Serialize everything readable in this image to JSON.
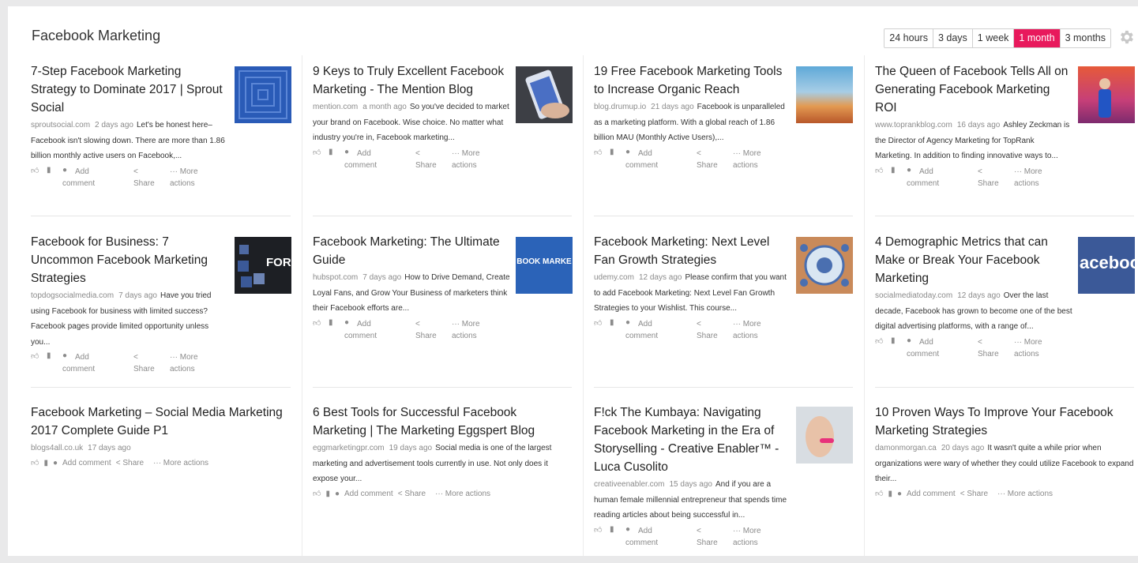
{
  "header": {
    "title": "Facebook Marketing",
    "time_filters": [
      "24 hours",
      "3 days",
      "1 week",
      "1 month",
      "3 months"
    ],
    "active_filter": "1 month",
    "accent": "#e8195c",
    "settings_icon": "gear-icon"
  },
  "actions": {
    "like_icon": "thumbs-up-icon",
    "bookmark_icon": "bookmark-icon",
    "comment_icon": "comment-icon",
    "share_icon": "share-icon",
    "more_icon": "ellipsis-icon",
    "add": "Add",
    "comment": "comment",
    "add_comment": "Add comment",
    "share": "Share",
    "more": "··· More",
    "more_actions_word": "actions",
    "more_actions": "··· More actions",
    "share_inline": "Share"
  },
  "articles": [
    {
      "title": "7-Step Facebook Marketing Strategy to Dominate 2017 | Sprout Social",
      "source": "sproutsocial.com",
      "age": "2 days ago",
      "snippet": "Let's be honest here–Facebook isn't slowing down. There are more than 1.86 billion monthly active users on Facebook,...",
      "thumbnail": "blue-maze"
    },
    {
      "title": "9 Keys to Truly Excellent Facebook Marketing - The Mention Blog",
      "source": "mention.com",
      "age": "a month ago",
      "snippet": "So you've decided to market your brand on Facebook. Wise choice. No matter what industry you're in, Facebook marketing...",
      "thumbnail": "hand-phone"
    },
    {
      "title": "19 Free Facebook Marketing Tools to Increase Organic Reach",
      "source": "blog.drumup.io",
      "age": "21 days ago",
      "snippet": "Facebook is unparalleled as a marketing platform. With a global reach of 1.86 billion MAU (Monthly Active Users),...",
      "thumbnail": "desert-sky"
    },
    {
      "title": "The Queen of Facebook Tells All on Generating Facebook Marketing ROI",
      "source": "www.toprankblog.com",
      "age": "16 days ago",
      "snippet": "Ashley Zeckman is the Director of Agency Marketing for TopRank Marketing. In addition to finding innovative ways to...",
      "thumbnail": "speaker-stage"
    },
    {
      "title": "Facebook for Business: 7 Uncommon Facebook Marketing Strategies",
      "source": "topdogsocialmedia.com",
      "age": "7 days ago",
      "snippet": "Have you tried using Facebook for business with limited success? Facebook pages provide limited opportunity unless you...",
      "thumbnail": "for-business",
      "thumb_text": "FOR"
    },
    {
      "title": "Facebook Marketing: The Ultimate Guide",
      "source": "hubspot.com",
      "age": "7 days ago",
      "snippet": "How to Drive Demand, Create Loyal Fans, and Grow Your Business of marketers think their Facebook efforts are...",
      "thumbnail": "guide-cover",
      "thumb_text": "BOOK MARKE"
    },
    {
      "title": "Facebook Marketing: Next Level Fan Growth Strategies",
      "source": "udemy.com",
      "age": "12 days ago",
      "snippet": "Please confirm that you want to add Facebook Marketing: Next Level Fan Growth Strategies to your Wishlist. This course...",
      "thumbnail": "network-hub"
    },
    {
      "title": "4 Demographic Metrics that can Make or Break Your Facebook Marketing",
      "source": "socialmediatoday.com",
      "age": "12 days ago",
      "snippet": "Over the last decade, Facebook has grown to become one of the best digital advertising platforms, with a range of...",
      "thumbnail": "facebook-logo",
      "thumb_text": "aceboo"
    },
    {
      "title": "Facebook Marketing – Social Media Marketing 2017 Complete Guide P1",
      "source": "blogs4all.co.uk",
      "age": "17 days ago",
      "snippet": "",
      "thumbnail": ""
    },
    {
      "title": "6 Best Tools for Successful Facebook Marketing | The Marketing Eggspert Blog",
      "source": "eggmarketingpr.com",
      "age": "19 days ago",
      "snippet": "Social media is one of the largest marketing and advertisement tools currently in use. Not only does it expose your...",
      "thumbnail": ""
    },
    {
      "title": "F!ck The Kumbaya: Navigating Facebook Marketing in the Era of Storyselling - Creative Enabler™ - Luca Cusolito",
      "source": "creativeenabler.com",
      "age": "15 days ago",
      "snippet": "And if you are a human female millennial entrepreneur that spends time reading articles about being successful in...",
      "thumbnail": "face-portrait"
    },
    {
      "title": "10 Proven Ways To Improve Your Facebook Marketing Strategies",
      "source": "damonmorgan.ca",
      "age": "20 days ago",
      "snippet": "It wasn't quite a while prior when organizations were wary of whether they could utilize Facebook to expand their...",
      "thumbnail": ""
    }
  ]
}
